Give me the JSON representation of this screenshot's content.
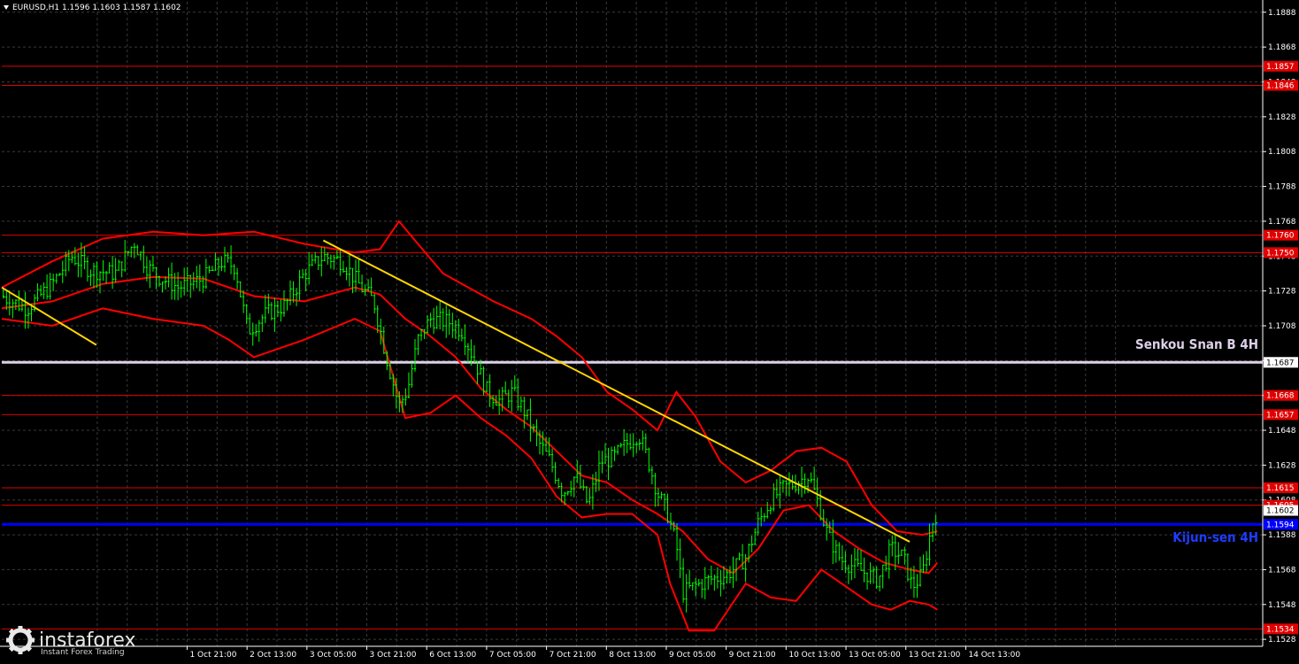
{
  "header": {
    "symbol_info": "EURUSD,H1  1.1596 1.1603 1.1587 1.1602"
  },
  "logo": {
    "name": "instaforex",
    "tagline": "Instant Forex Trading"
  },
  "annotations": {
    "senkou": "Senkou Snan B 4H",
    "kijun": "Kijun-sen 4H"
  },
  "colors": {
    "background": "#000000",
    "grid": "#3a3a3a",
    "candles": "#00ff00",
    "bands": "#ff0000",
    "levels": "#e00000",
    "trendline": "#ffd700",
    "senkou": "#dcd0e8",
    "kijun": "#0000ff",
    "axis_text": "#ffffff"
  },
  "chart_data": {
    "type": "candlestick",
    "symbol": "EURUSD",
    "timeframe": "H1",
    "ohlc_current": {
      "open": 1.1596,
      "high": 1.1603,
      "low": 1.1587,
      "close": 1.1602
    },
    "ylim": [
      1.1524,
      1.1894
    ],
    "y_ticks": [
      1.1888,
      1.1868,
      1.1848,
      1.1828,
      1.1808,
      1.1788,
      1.1768,
      1.1748,
      1.1728,
      1.1708,
      1.1688,
      1.1668,
      1.1648,
      1.1628,
      1.1608,
      1.1588,
      1.1568,
      1.1548,
      1.1528
    ],
    "x_ticks": [
      "1 Oct 21:00",
      "2 Oct 13:00",
      "3 Oct 05:00",
      "3 Oct 21:00",
      "6 Oct 13:00",
      "7 Oct 05:00",
      "7 Oct 21:00",
      "8 Oct 13:00",
      "9 Oct 05:00",
      "9 Oct 21:00",
      "10 Oct 13:00",
      "13 Oct 05:00",
      "13 Oct 21:00",
      "14 Oct 13:00"
    ],
    "horizontal_levels": [
      {
        "label": "1.1857",
        "value": 1.1857
      },
      {
        "label": "1.1846",
        "value": 1.1846
      },
      {
        "label": "1.1760",
        "value": 1.176
      },
      {
        "label": "1.1750",
        "value": 1.175
      },
      {
        "label": "1.1668",
        "value": 1.1668
      },
      {
        "label": "1.1657",
        "value": 1.1657
      },
      {
        "label": "1.1615",
        "value": 1.1615
      },
      {
        "label": "1.1605",
        "value": 1.1605
      },
      {
        "label": "1.1534",
        "value": 1.1534
      }
    ],
    "senkou_span_b": {
      "label": "1.1687",
      "value": 1.1687
    },
    "kijun_sen": {
      "label": "1.1594",
      "value": 1.1594
    },
    "current_price_label": "1.1602",
    "trendlines": [
      {
        "x0": 0.0,
        "y0": 1.173,
        "x1": 0.075,
        "y1": 1.1697
      },
      {
        "x0": 0.255,
        "y0": 1.1757,
        "x1": 0.72,
        "y1": 1.1584
      }
    ],
    "price_path": [
      [
        0.0,
        1.1725
      ],
      [
        0.02,
        1.1718
      ],
      [
        0.04,
        1.1732
      ],
      [
        0.055,
        1.1748
      ],
      [
        0.07,
        1.174
      ],
      [
        0.09,
        1.1738
      ],
      [
        0.105,
        1.1756
      ],
      [
        0.115,
        1.1742
      ],
      [
        0.125,
        1.1736
      ],
      [
        0.14,
        1.173
      ],
      [
        0.16,
        1.1735
      ],
      [
        0.175,
        1.1745
      ],
      [
        0.185,
        1.1742
      ],
      [
        0.195,
        1.1705
      ],
      [
        0.21,
        1.1715
      ],
      [
        0.225,
        1.172
      ],
      [
        0.24,
        1.1738
      ],
      [
        0.255,
        1.1748
      ],
      [
        0.27,
        1.1745
      ],
      [
        0.285,
        1.173
      ],
      [
        0.295,
        1.1722
      ],
      [
        0.305,
        1.169
      ],
      [
        0.315,
        1.1662
      ],
      [
        0.322,
        1.1672
      ],
      [
        0.33,
        1.17
      ],
      [
        0.34,
        1.1712
      ],
      [
        0.355,
        1.171
      ],
      [
        0.365,
        1.1705
      ],
      [
        0.375,
        1.1688
      ],
      [
        0.385,
        1.167
      ],
      [
        0.395,
        1.1665
      ],
      [
        0.405,
        1.167
      ],
      [
        0.415,
        1.1658
      ],
      [
        0.425,
        1.1642
      ],
      [
        0.435,
        1.163
      ],
      [
        0.445,
        1.1612
      ],
      [
        0.455,
        1.1622
      ],
      [
        0.465,
        1.1605
      ],
      [
        0.475,
        1.163
      ],
      [
        0.485,
        1.1632
      ],
      [
        0.495,
        1.164
      ],
      [
        0.505,
        1.1646
      ],
      [
        0.512,
        1.1632
      ],
      [
        0.52,
        1.1612
      ],
      [
        0.528,
        1.16
      ],
      [
        0.535,
        1.1582
      ],
      [
        0.54,
        1.1555
      ],
      [
        0.548,
        1.1558
      ],
      [
        0.56,
        1.1562
      ],
      [
        0.575,
        1.1565
      ],
      [
        0.59,
        1.1575
      ],
      [
        0.6,
        1.1595
      ],
      [
        0.61,
        1.1608
      ],
      [
        0.62,
        1.1615
      ],
      [
        0.63,
        1.1618
      ],
      [
        0.64,
        1.1622
      ],
      [
        0.648,
        1.1605
      ],
      [
        0.655,
        1.1588
      ],
      [
        0.665,
        1.1574
      ],
      [
        0.675,
        1.157
      ],
      [
        0.685,
        1.1566
      ],
      [
        0.695,
        1.1562
      ],
      [
        0.705,
        1.158
      ],
      [
        0.715,
        1.1575
      ],
      [
        0.722,
        1.1558
      ],
      [
        0.73,
        1.1565
      ],
      [
        0.738,
        1.1595
      ],
      [
        0.742,
        1.1602
      ]
    ],
    "band_upper": [
      [
        0.0,
        1.173
      ],
      [
        0.04,
        1.1745
      ],
      [
        0.08,
        1.1758
      ],
      [
        0.12,
        1.1762
      ],
      [
        0.16,
        1.176
      ],
      [
        0.2,
        1.1762
      ],
      [
        0.24,
        1.1755
      ],
      [
        0.28,
        1.175
      ],
      [
        0.3,
        1.1752
      ],
      [
        0.315,
        1.1768
      ],
      [
        0.33,
        1.1755
      ],
      [
        0.35,
        1.1738
      ],
      [
        0.37,
        1.173
      ],
      [
        0.39,
        1.1722
      ],
      [
        0.42,
        1.1712
      ],
      [
        0.44,
        1.1702
      ],
      [
        0.46,
        1.169
      ],
      [
        0.48,
        1.167
      ],
      [
        0.5,
        1.166
      ],
      [
        0.52,
        1.1648
      ],
      [
        0.535,
        1.167
      ],
      [
        0.55,
        1.1656
      ],
      [
        0.57,
        1.163
      ],
      [
        0.59,
        1.1618
      ],
      [
        0.61,
        1.1625
      ],
      [
        0.63,
        1.1636
      ],
      [
        0.65,
        1.1638
      ],
      [
        0.67,
        1.163
      ],
      [
        0.69,
        1.1605
      ],
      [
        0.71,
        1.159
      ],
      [
        0.73,
        1.1588
      ],
      [
        0.742,
        1.159
      ]
    ],
    "band_middle": [
      [
        0.0,
        1.1718
      ],
      [
        0.04,
        1.1722
      ],
      [
        0.08,
        1.1732
      ],
      [
        0.12,
        1.1736
      ],
      [
        0.16,
        1.1735
      ],
      [
        0.2,
        1.1725
      ],
      [
        0.24,
        1.1722
      ],
      [
        0.28,
        1.173
      ],
      [
        0.3,
        1.1726
      ],
      [
        0.32,
        1.1712
      ],
      [
        0.34,
        1.1702
      ],
      [
        0.36,
        1.169
      ],
      [
        0.38,
        1.1672
      ],
      [
        0.4,
        1.166
      ],
      [
        0.42,
        1.165
      ],
      [
        0.44,
        1.1636
      ],
      [
        0.46,
        1.1622
      ],
      [
        0.48,
        1.1618
      ],
      [
        0.5,
        1.1608
      ],
      [
        0.52,
        1.16
      ],
      [
        0.54,
        1.159
      ],
      [
        0.56,
        1.1574
      ],
      [
        0.58,
        1.1566
      ],
      [
        0.6,
        1.158
      ],
      [
        0.62,
        1.1602
      ],
      [
        0.64,
        1.1605
      ],
      [
        0.66,
        1.159
      ],
      [
        0.68,
        1.158
      ],
      [
        0.7,
        1.1572
      ],
      [
        0.72,
        1.1568
      ],
      [
        0.735,
        1.1566
      ],
      [
        0.742,
        1.1572
      ]
    ],
    "band_lower": [
      [
        0.0,
        1.1712
      ],
      [
        0.04,
        1.1708
      ],
      [
        0.08,
        1.1718
      ],
      [
        0.12,
        1.1712
      ],
      [
        0.16,
        1.1708
      ],
      [
        0.18,
        1.17
      ],
      [
        0.2,
        1.169
      ],
      [
        0.24,
        1.17
      ],
      [
        0.28,
        1.1712
      ],
      [
        0.3,
        1.1705
      ],
      [
        0.32,
        1.1655
      ],
      [
        0.34,
        1.1658
      ],
      [
        0.36,
        1.1668
      ],
      [
        0.38,
        1.1655
      ],
      [
        0.4,
        1.1645
      ],
      [
        0.42,
        1.1632
      ],
      [
        0.44,
        1.161
      ],
      [
        0.46,
        1.1598
      ],
      [
        0.48,
        1.16
      ],
      [
        0.5,
        1.16
      ],
      [
        0.52,
        1.1588
      ],
      [
        0.53,
        1.156
      ],
      [
        0.545,
        1.1533
      ],
      [
        0.565,
        1.1533
      ],
      [
        0.59,
        1.156
      ],
      [
        0.61,
        1.1552
      ],
      [
        0.63,
        1.155
      ],
      [
        0.65,
        1.1568
      ],
      [
        0.67,
        1.1558
      ],
      [
        0.69,
        1.1548
      ],
      [
        0.705,
        1.1545
      ],
      [
        0.72,
        1.155
      ],
      [
        0.735,
        1.1548
      ],
      [
        0.742,
        1.1545
      ]
    ]
  }
}
